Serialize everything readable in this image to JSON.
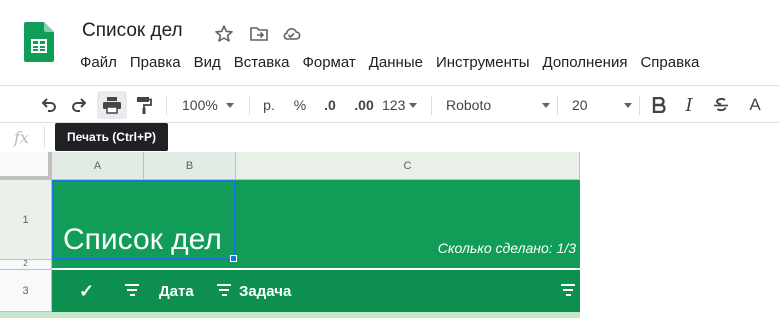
{
  "app": {
    "title": "Список дел",
    "icons": [
      "sheets-logo-icon",
      "star-icon",
      "move-folder-icon",
      "cloud-saved-icon"
    ]
  },
  "menu": [
    "Файл",
    "Правка",
    "Вид",
    "Вставка",
    "Формат",
    "Данные",
    "Инструменты",
    "Дополнения",
    "Справка"
  ],
  "toolbar": {
    "zoom": "100%",
    "currency": "р.",
    "percent": "%",
    "decrease_decimals": ".0",
    "increase_decimals": ".00",
    "more_formats": "123",
    "font": "Roboto",
    "font_size": "20",
    "italic": "I",
    "text_color": "A"
  },
  "formula_bar": {
    "fx_label": "fx"
  },
  "tooltip": "Печать (Ctrl+P)",
  "grid": {
    "columns": [
      "A",
      "B",
      "C"
    ],
    "rows": [
      "1",
      "2",
      "3"
    ],
    "banner_title": "Список дел",
    "status": "Сколько сделано: 1/3",
    "header": {
      "check": "✓",
      "date": "Дата",
      "task": "Задача"
    }
  },
  "colors": {
    "banner": "#119d58",
    "header_row": "#0d8f4f",
    "selection": "#1a73e8"
  }
}
